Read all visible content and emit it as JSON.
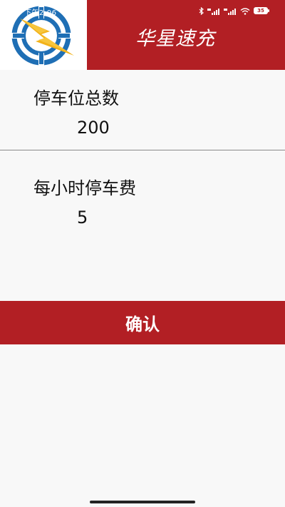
{
  "status_bar": {
    "time": "下午2:06",
    "battery": "35",
    "icons": [
      "bluetooth-icon",
      "hd-signal-icon",
      "hd-signal-icon",
      "wifi-icon",
      "battery-icon"
    ]
  },
  "header": {
    "title": "华星速充",
    "logo": "lightning-target-logo"
  },
  "form": {
    "total_spaces_label": "停车位总数",
    "total_spaces_value": "200",
    "hourly_fee_label": "每小时停车费",
    "hourly_fee_value": "5"
  },
  "actions": {
    "confirm_label": "确认"
  },
  "colors": {
    "brand_red": "#b21f24",
    "logo_blue": "#1f6fb5",
    "logo_yellow": "#f2b21a",
    "background": "#f8f8f8"
  }
}
